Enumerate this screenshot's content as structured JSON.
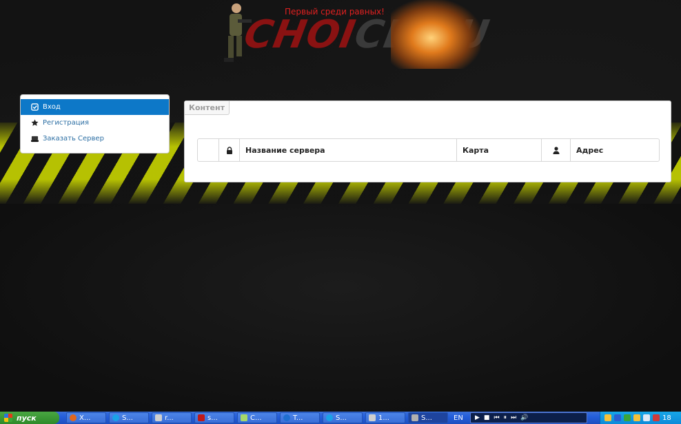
{
  "header": {
    "slogan": "Первый среди равных!",
    "logo_text_red": "CHOI",
    "logo_text_gray": "CE.RU"
  },
  "menu": {
    "items": [
      {
        "label": "Вход",
        "icon": "checkbox-icon",
        "active": true
      },
      {
        "label": "Регистрация",
        "icon": "star-icon",
        "active": false
      },
      {
        "label": "Заказать Сервер",
        "icon": "server-icon",
        "active": false
      }
    ]
  },
  "content": {
    "tab_label": "Контент",
    "table": {
      "columns": [
        "",
        "lock-icon",
        "Название сервера",
        "Карта",
        "user-icon",
        "Адрес"
      ]
    }
  },
  "taskbar": {
    "start_label": "пуск",
    "tasks": [
      {
        "label": "X...",
        "icon": "firefox-icon",
        "color": "#e0661f"
      },
      {
        "label": "S...",
        "icon": "skype-icon",
        "color": "#1aa2e6"
      },
      {
        "label": "r...",
        "icon": "python-icon",
        "color": "#cfcfcf"
      },
      {
        "label": "s...",
        "icon": "filezilla-icon",
        "color": "#c01a1a"
      },
      {
        "label": "C...",
        "icon": "notepad-icon",
        "color": "#a6d86b"
      },
      {
        "label": "T...",
        "icon": "teamviewer-icon",
        "color": "#1f6fd0"
      },
      {
        "label": "S...",
        "icon": "skype-icon",
        "color": "#1aa2e6"
      },
      {
        "label": "1...",
        "icon": "python-icon",
        "color": "#cfcfcf"
      },
      {
        "label": "S...",
        "icon": "camera-icon",
        "color": "#b0b0b0",
        "active": true
      }
    ],
    "language": "EN",
    "clock": "18"
  },
  "colors": {
    "menu_active_bg": "#0d78c8",
    "link_color": "#2b6ea3",
    "hazard_yellow": "#c8d400",
    "slogan_red": "#e02020"
  }
}
